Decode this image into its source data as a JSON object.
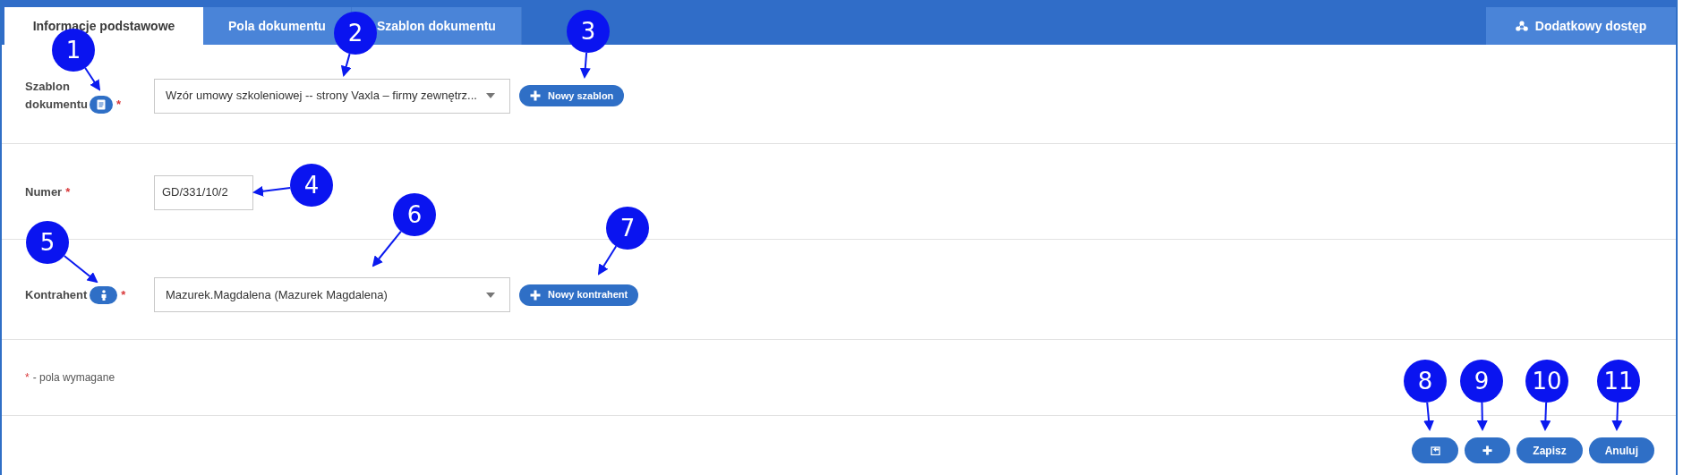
{
  "tabs": [
    {
      "label": "Informacje podstawowe",
      "selected": true
    },
    {
      "label": "Pola dokumentu",
      "selected": false
    },
    {
      "label": "Szablon dokumentu",
      "selected": false
    }
  ],
  "extra_tab": {
    "label": "Dodatkowy dostęp"
  },
  "form": {
    "template": {
      "label": "Szablon dokumentu",
      "required_mark": "*",
      "value": "Wzór umowy szkoleniowej -- strony Vaxla – firmy zewnętrz...",
      "button": "Nowy szablon"
    },
    "number": {
      "label": "Numer",
      "required_mark": "*",
      "value": "GD/331/10/2"
    },
    "contractor": {
      "label": "Kontrahent",
      "required_mark": "*",
      "value": "Mazurek.Magdalena (Mazurek Magdalena)",
      "button": "Nowy kontrahent"
    }
  },
  "legend": {
    "mark": "*",
    "text": "- pola wymagane"
  },
  "actions": [
    {
      "kind": "return"
    },
    {
      "kind": "add"
    },
    {
      "kind": "text",
      "label": "Zapisz"
    },
    {
      "kind": "text",
      "label": "Anuluj"
    }
  ],
  "callouts": [
    {
      "label": "1"
    },
    {
      "label": "2"
    },
    {
      "label": "3"
    },
    {
      "label": "4"
    },
    {
      "label": "5"
    },
    {
      "label": "6"
    },
    {
      "label": "7"
    },
    {
      "label": "8"
    },
    {
      "label": "9"
    },
    {
      "label": "10"
    },
    {
      "label": "11"
    }
  ]
}
